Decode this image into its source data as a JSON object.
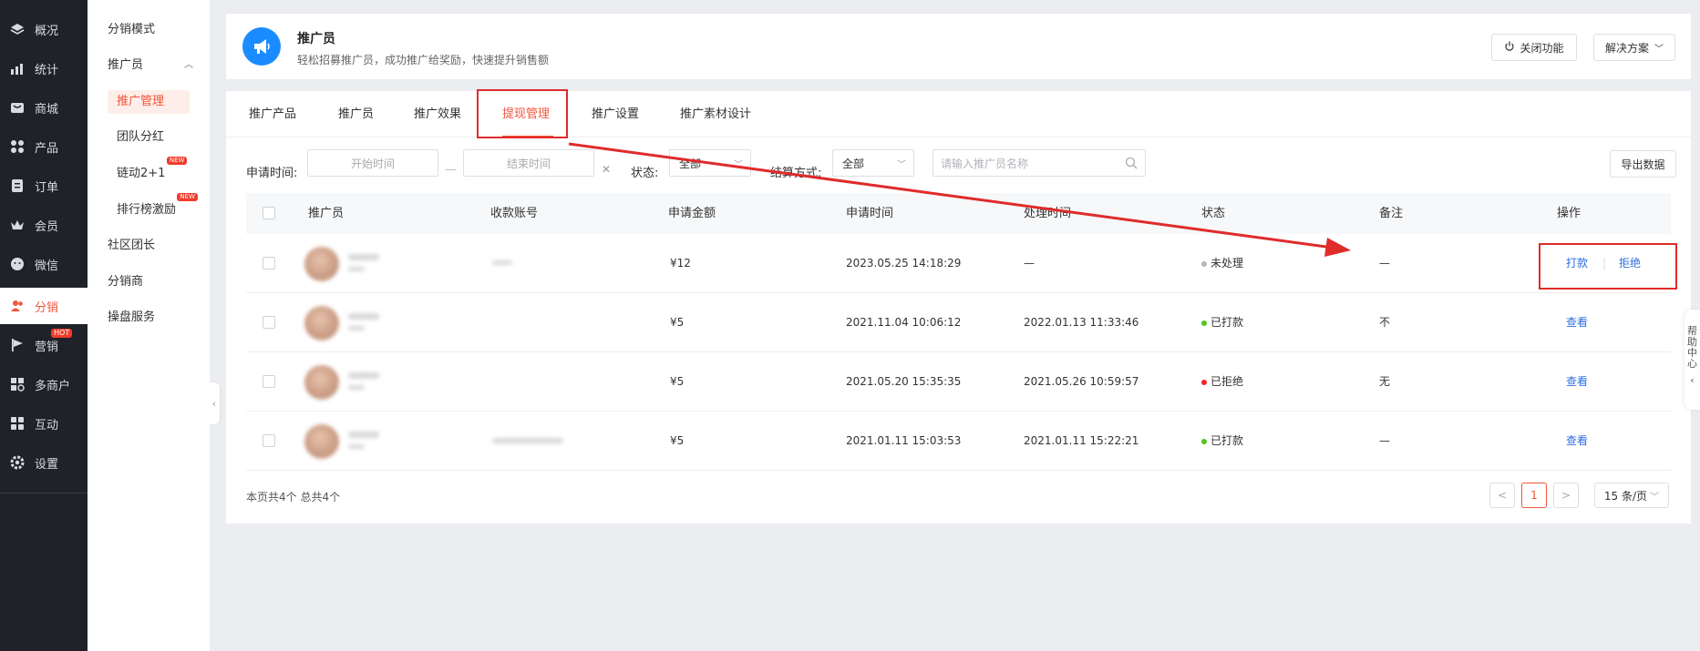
{
  "nav": {
    "items": [
      {
        "label": "概况",
        "icon": "layers-icon"
      },
      {
        "label": "统计",
        "icon": "chart-icon"
      },
      {
        "label": "商城",
        "icon": "shop-icon"
      },
      {
        "label": "产品",
        "icon": "grid-icon"
      },
      {
        "label": "订单",
        "icon": "order-icon"
      },
      {
        "label": "会员",
        "icon": "crown-icon"
      },
      {
        "label": "微信",
        "icon": "wechat-icon"
      },
      {
        "label": "分销",
        "icon": "users-icon"
      },
      {
        "label": "营销",
        "icon": "flag-icon",
        "badge": "HOT"
      },
      {
        "label": "多商户",
        "icon": "store-icon"
      },
      {
        "label": "互动",
        "icon": "interact-icon"
      },
      {
        "label": "设置",
        "icon": "gear-icon"
      }
    ],
    "active_index": 7
  },
  "subnav": {
    "mode": "分销模式",
    "promoter": "推广员",
    "promoter_children": [
      "推广管理",
      "团队分红",
      "链动2+1",
      "排行榜激励"
    ],
    "new_badge": "NEW",
    "community": "社区团长",
    "distributor": "分销商",
    "operation": "操盘服务"
  },
  "header": {
    "title": "推广员",
    "subtitle": "轻松招募推广员，成功推广给奖励，快速提升销售额",
    "close_btn": "关闭功能",
    "solution_btn": "解决方案"
  },
  "tabs": [
    "推广产品",
    "推广员",
    "推广效果",
    "提现管理",
    "推广设置",
    "推广素材设计"
  ],
  "active_tab": 3,
  "filters": {
    "apply_time_label": "申请时间:",
    "start_placeholder": "开始时间",
    "range_sep": "—",
    "end_placeholder": "结束时间",
    "clear": "✕",
    "status_label": "状态:",
    "status_value": "全部",
    "settle_label": "结算方式:",
    "settle_value": "全部",
    "search_placeholder": "请输入推广员名称",
    "export_btn": "导出数据"
  },
  "table": {
    "columns": [
      "推广员",
      "收款账号",
      "申请金额",
      "申请时间",
      "处理时间",
      "状态",
      "备注",
      "操作"
    ],
    "rows": [
      {
        "amount": "¥12",
        "apply_time": "2023.05.25 14:18:29",
        "process_time": "—",
        "status": "未处理",
        "status_color": "#b5b5b5",
        "remark": "—",
        "actions": [
          "打款",
          "拒绝"
        ]
      },
      {
        "amount": "¥5",
        "apply_time": "2021.11.04 10:06:12",
        "process_time": "2022.01.13 11:33:46",
        "status": "已打款",
        "status_color": "#52c41a",
        "remark": "不",
        "actions": [
          "查看"
        ]
      },
      {
        "amount": "¥5",
        "apply_time": "2021.05.20 15:35:35",
        "process_time": "2021.05.26 10:59:57",
        "status": "已拒绝",
        "status_color": "#f5222d",
        "remark": "无",
        "actions": [
          "查看"
        ]
      },
      {
        "amount": "¥5",
        "apply_time": "2021.01.11 15:03:53",
        "process_time": "2021.01.11 15:22:21",
        "status": "已打款",
        "status_color": "#52c41a",
        "remark": "—",
        "actions": [
          "查看"
        ]
      }
    ]
  },
  "footer": {
    "summary": "本页共4个 总共4个",
    "prev": "<",
    "page": "1",
    "next": ">",
    "page_size": "15 条/页"
  },
  "help": [
    "帮",
    "助",
    "中",
    "心"
  ],
  "colors": {
    "accent": "#f0553b",
    "nav_bg": "#1f2228",
    "link": "#2d6de0",
    "annotation": "#e02b2b"
  }
}
